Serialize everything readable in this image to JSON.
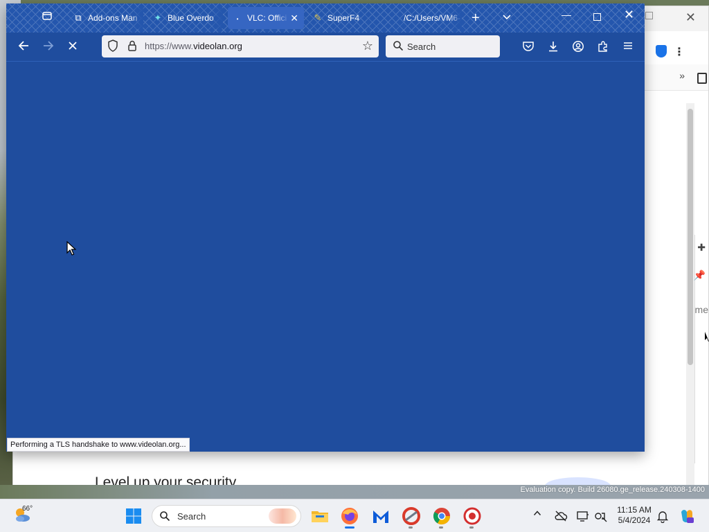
{
  "browser": {
    "tabs": [
      {
        "label": "Add-ons Man",
        "icon": "puzzle-icon"
      },
      {
        "label": "Blue Overdo",
        "icon": "blue-overdose-icon"
      },
      {
        "label": "VLC: Offici",
        "icon": "vlc-icon",
        "active": true
      },
      {
        "label": "SuperF4",
        "icon": "superf4-icon"
      },
      {
        "label": "/C:/Users/VM6-",
        "icon": "file-icon"
      }
    ],
    "url": {
      "prefix": "https://www.",
      "host": "videolan.org"
    },
    "search_placeholder": "Search",
    "status_text": "Performing a TLS handshake to www.videolan.org...",
    "page_color": "#1f4d9e",
    "tabstrip_color": "#2456ad"
  },
  "background_window": {
    "heading": "Level up your security",
    "side_text": "me"
  },
  "desktop": {
    "evaluation_text": "Evaluation copy. Build 26080.ge_release.240308-1400"
  },
  "taskbar": {
    "weather_temp": "66°",
    "search_placeholder": "Search",
    "apps": [
      "file-explorer-icon",
      "firefox-icon",
      "malwarebytes-icon",
      "ccleaner-icon",
      "chrome-icon",
      "media-app-icon"
    ],
    "clock_time": "11:15 AM",
    "clock_date": "5/4/2024"
  }
}
